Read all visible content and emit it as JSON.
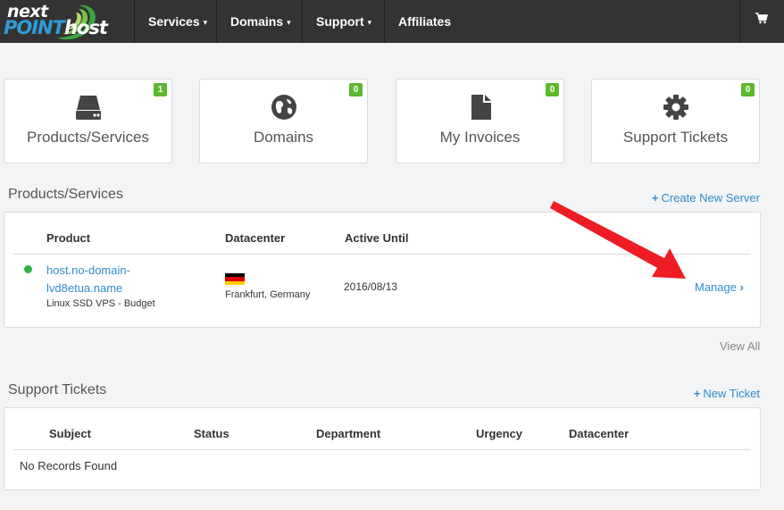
{
  "brand": {
    "line1": "next",
    "line2a": "POINT",
    "line2b": "host"
  },
  "nav": [
    {
      "label": "Services",
      "has_caret": true
    },
    {
      "label": "Domains",
      "has_caret": true
    },
    {
      "label": "Support",
      "has_caret": true
    },
    {
      "label": "Affiliates",
      "has_caret": false
    }
  ],
  "nav_caret": "▾",
  "cart_icon": "shopping-cart-icon",
  "tiles": [
    {
      "label": "Products/Services",
      "count": "1",
      "icon": "server-icon"
    },
    {
      "label": "Domains",
      "count": "0",
      "icon": "globe-icon"
    },
    {
      "label": "My Invoices",
      "count": "0",
      "icon": "document-icon"
    },
    {
      "label": "Support Tickets",
      "count": "0",
      "icon": "gear-icon"
    }
  ],
  "products": {
    "title": "Products/Services",
    "create_link": "Create New Server",
    "plus": "+",
    "columns": [
      "Product",
      "Datacenter",
      "Active Until"
    ],
    "rows": [
      {
        "status_color": "#32b047",
        "name_line1": "host.no-domain-",
        "name_line2": "lvd8etua.name",
        "plan": "Linux SSD VPS - Budget",
        "datacenter": "Frankfurt, Germany",
        "flag_colors": [
          "#000000",
          "#dd0000",
          "#ffce00"
        ],
        "active_until": "2016/08/13",
        "action": "Manage",
        "action_chevron": "›"
      }
    ],
    "view_all": "View All"
  },
  "tickets": {
    "title": "Support Tickets",
    "new_link": "New Ticket",
    "plus": "+",
    "columns": [
      "Subject",
      "Status",
      "Department",
      "Urgency",
      "Datacenter"
    ],
    "empty": "No Records Found"
  },
  "colors": {
    "accent": "#2e8fc9",
    "badge": "#5cb82c",
    "nav_bg": "#333333",
    "annotation_arrow": "#ee1c24"
  }
}
